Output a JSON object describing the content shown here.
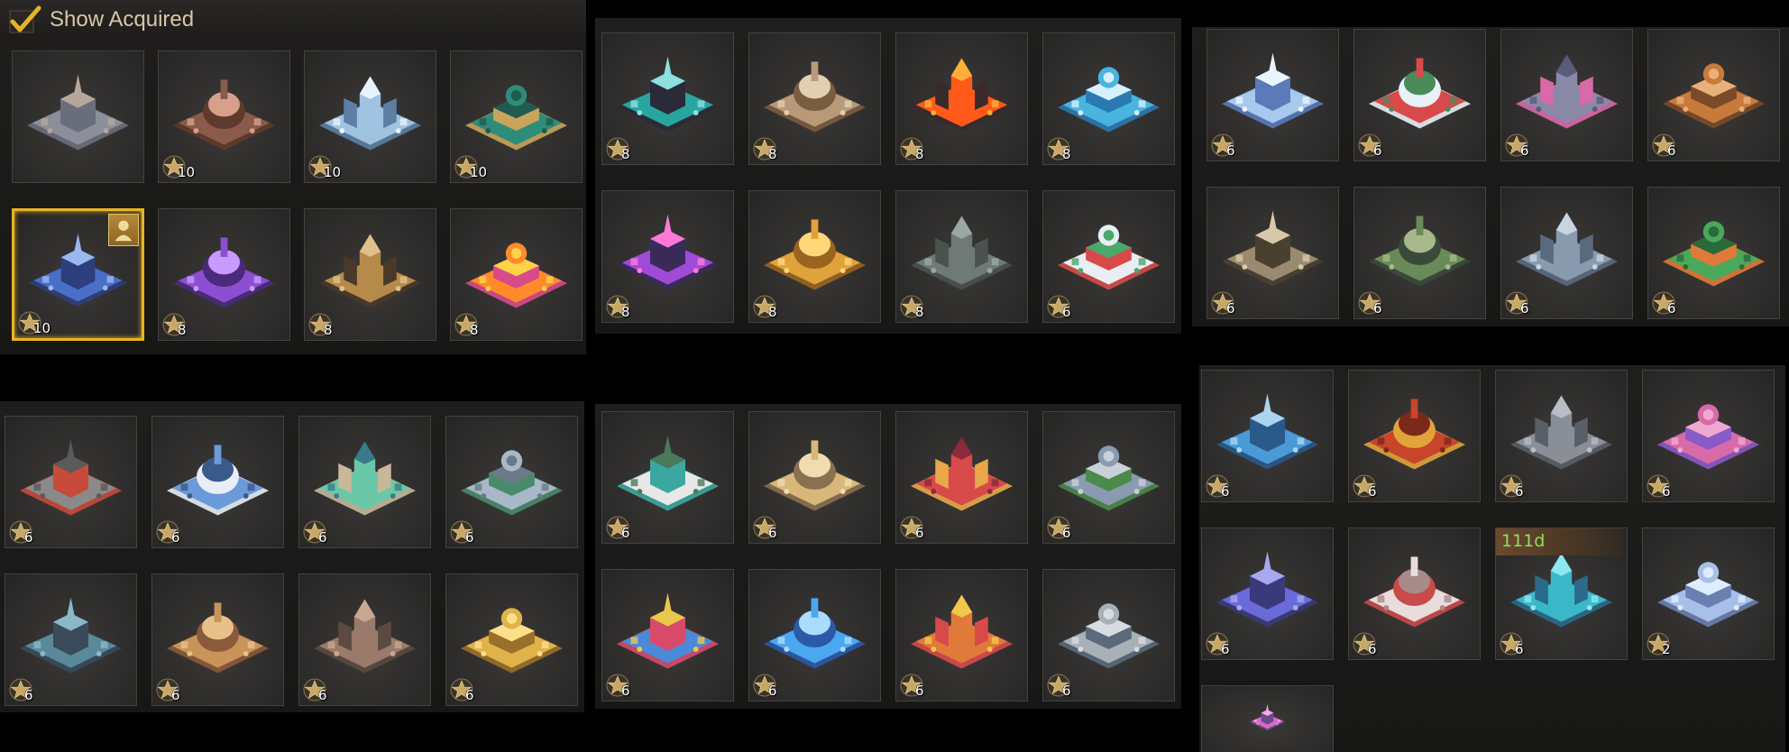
{
  "header": {
    "show_acquired_label": "Show Acquired"
  },
  "colors": {
    "star": "#c9a865",
    "selected_border": "#e6b424",
    "timer_text": "#8fe05a"
  },
  "panels": [
    {
      "id": "p1",
      "tiles": [
        {
          "name": "gray-fortress",
          "stars": "",
          "selected": false,
          "palette": [
            "#8b8f9c",
            "#6a6e7c",
            "#b7a79a"
          ]
        },
        {
          "name": "doll-face-building",
          "stars": "10",
          "selected": false,
          "palette": [
            "#8a5a4a",
            "#5e3b2c",
            "#d6a08a"
          ]
        },
        {
          "name": "cloud-city",
          "stars": "10",
          "selected": false,
          "palette": [
            "#9fc3e0",
            "#5d7fa3",
            "#e8f2fb"
          ]
        },
        {
          "name": "jade-palace",
          "stars": "10",
          "selected": false,
          "palette": [
            "#2e8c7a",
            "#caa45a",
            "#1f5b4f"
          ]
        },
        {
          "name": "blue-castle",
          "stars": "10",
          "selected": true,
          "owner": true,
          "palette": [
            "#4a6fc9",
            "#2d3f7c",
            "#9bb7ef"
          ]
        },
        {
          "name": "purple-mech",
          "stars": "8",
          "selected": false,
          "palette": [
            "#8b4fd1",
            "#4b2a7c",
            "#c79aff"
          ]
        },
        {
          "name": "skull-clockwork",
          "stars": "8",
          "selected": false,
          "palette": [
            "#b58a4a",
            "#4a3828",
            "#e0c08a"
          ]
        },
        {
          "name": "pumpkin-lantern",
          "stars": "8",
          "selected": false,
          "palette": [
            "#ff8a2a",
            "#d84a8a",
            "#ffd24a"
          ]
        }
      ]
    },
    {
      "id": "p2",
      "tiles": [
        {
          "name": "pirate-ship",
          "stars": "8",
          "selected": false,
          "palette": [
            "#27a6a0",
            "#2a2a38",
            "#8de0e0"
          ]
        },
        {
          "name": "cat-statue",
          "stars": "8",
          "selected": false,
          "palette": [
            "#b89a78",
            "#7a5c40",
            "#e2cfb2"
          ]
        },
        {
          "name": "lava-volcano",
          "stars": "8",
          "selected": false,
          "palette": [
            "#ff5a1a",
            "#3a2a2a",
            "#ffae3a"
          ]
        },
        {
          "name": "ice-spire-plaza",
          "stars": "8",
          "selected": false,
          "palette": [
            "#4ab4e0",
            "#2a7ab0",
            "#d6f0ff"
          ]
        },
        {
          "name": "neon-arcade",
          "stars": "8",
          "selected": false,
          "palette": [
            "#a04ad8",
            "#3a2a5a",
            "#ff7ad8"
          ]
        },
        {
          "name": "golden-dragon",
          "stars": "8",
          "selected": false,
          "palette": [
            "#e0a23a",
            "#9a6420",
            "#ffd67a"
          ]
        },
        {
          "name": "stone-fort",
          "stars": "8",
          "selected": false,
          "palette": [
            "#6f7a76",
            "#4a524e",
            "#9aa8a2"
          ]
        },
        {
          "name": "snowman-festival",
          "stars": "6",
          "selected": false,
          "palette": [
            "#e8eef4",
            "#d84a4a",
            "#4aa86a"
          ]
        }
      ]
    },
    {
      "id": "p3",
      "tiles": [
        {
          "name": "frost-castle",
          "stars": "6",
          "selected": false,
          "palette": [
            "#a8c8ee",
            "#5a7ab8",
            "#eaf4ff"
          ]
        },
        {
          "name": "snow-globe",
          "stars": "6",
          "selected": false,
          "palette": [
            "#d84a4a",
            "#e8f0f8",
            "#4a8a5a"
          ]
        },
        {
          "name": "carnival-block",
          "stars": "6",
          "selected": false,
          "palette": [
            "#8a8aa8",
            "#d86aa8",
            "#5a5a7a"
          ]
        },
        {
          "name": "turkey-house",
          "stars": "6",
          "selected": false,
          "palette": [
            "#c87a3a",
            "#7a4a2a",
            "#e8b07a"
          ]
        },
        {
          "name": "skull-machine",
          "stars": "6",
          "selected": false,
          "palette": [
            "#9a8a70",
            "#4a4030",
            "#d8c8a8"
          ]
        },
        {
          "name": "dragon-temple",
          "stars": "6",
          "selected": false,
          "palette": [
            "#6a8a5a",
            "#3a4a3a",
            "#a8b88a"
          ]
        },
        {
          "name": "grand-hall",
          "stars": "6",
          "selected": false,
          "palette": [
            "#8a9aae",
            "#5a6a7e",
            "#c8d4e0"
          ]
        },
        {
          "name": "tropical-garden",
          "stars": "6",
          "selected": false,
          "palette": [
            "#4aa85a",
            "#e07a3a",
            "#2a6a3a"
          ]
        }
      ]
    },
    {
      "id": "p4",
      "tiles": [
        {
          "name": "military-base",
          "stars": "6",
          "selected": false,
          "palette": [
            "#8a8a8a",
            "#c84a3a",
            "#5a5a5a"
          ]
        },
        {
          "name": "research-lab",
          "stars": "6",
          "selected": false,
          "palette": [
            "#6a9ad8",
            "#e8eef6",
            "#3a5a8a"
          ]
        },
        {
          "name": "sports-complex",
          "stars": "6",
          "selected": false,
          "palette": [
            "#6ac8a8",
            "#c8b89a",
            "#3a7a8a"
          ]
        },
        {
          "name": "stadium",
          "stars": "6",
          "selected": false,
          "palette": [
            "#a8b8c8",
            "#4a8a6a",
            "#6a7a8a"
          ]
        },
        {
          "name": "haunted-mansion",
          "stars": "6",
          "selected": false,
          "palette": [
            "#5a8a9a",
            "#3a4a5a",
            "#8ab8c8"
          ]
        },
        {
          "name": "market-district",
          "stars": "6",
          "selected": false,
          "palette": [
            "#c8945a",
            "#8a5a3a",
            "#e8c08a"
          ]
        },
        {
          "name": "industrial-works",
          "stars": "6",
          "selected": false,
          "palette": [
            "#9a7a6a",
            "#5a4a40",
            "#c8a890"
          ]
        },
        {
          "name": "golden-moon-palace",
          "stars": "6",
          "selected": false,
          "palette": [
            "#e0b24a",
            "#9a7028",
            "#fae08a"
          ]
        }
      ]
    },
    {
      "id": "p5",
      "tiles": [
        {
          "name": "modern-villa",
          "stars": "6",
          "selected": false,
          "palette": [
            "#e8e8e8",
            "#3aa8a0",
            "#4a7a5a"
          ]
        },
        {
          "name": "domed-temple",
          "stars": "6",
          "selected": false,
          "palette": [
            "#d8b87a",
            "#8a7050",
            "#f0dcb0"
          ]
        },
        {
          "name": "festival-stage",
          "stars": "6",
          "selected": false,
          "palette": [
            "#d84a4a",
            "#e8a84a",
            "#8a2a3a"
          ]
        },
        {
          "name": "opera-house",
          "stars": "6",
          "selected": false,
          "palette": [
            "#8a9ab0",
            "#4a8a4a",
            "#c8d0da"
          ]
        },
        {
          "name": "fairground",
          "stars": "6",
          "selected": false,
          "palette": [
            "#4a8ad8",
            "#d84a6a",
            "#e8c84a"
          ]
        },
        {
          "name": "rabbit-ice-statue",
          "stars": "6",
          "selected": false,
          "palette": [
            "#4aa8f0",
            "#2a5aa8",
            "#aadcff"
          ]
        },
        {
          "name": "bunny-circus",
          "stars": "6",
          "selected": false,
          "palette": [
            "#e07a3a",
            "#d84a4a",
            "#f0c84a"
          ]
        },
        {
          "name": "imperial-compound",
          "stars": "6",
          "selected": false,
          "palette": [
            "#a8b0b8",
            "#5a6a7a",
            "#d8dce0"
          ]
        }
      ]
    },
    {
      "id": "p6",
      "tiles": [
        {
          "name": "observatory-dome",
          "stars": "6",
          "selected": false,
          "palette": [
            "#4a9ad8",
            "#2a5a8a",
            "#aad4f0"
          ]
        },
        {
          "name": "red-pagoda",
          "stars": "6",
          "selected": false,
          "palette": [
            "#c8442a",
            "#e0a43a",
            "#7a2a1a"
          ]
        },
        {
          "name": "tank-fortress",
          "stars": "6",
          "selected": false,
          "palette": [
            "#8a8e96",
            "#5a5e66",
            "#b8bcc4"
          ]
        },
        {
          "name": "love-carnival",
          "stars": "6",
          "selected": false,
          "palette": [
            "#d86aa8",
            "#8a5ac8",
            "#f0a8d0"
          ]
        },
        {
          "name": "violet-castle",
          "stars": "6",
          "selected": false,
          "palette": [
            "#6a6ad8",
            "#3a3a7a",
            "#a8a8f0"
          ]
        },
        {
          "name": "winter-palace",
          "stars": "6",
          "selected": false,
          "palette": [
            "#e8dcdc",
            "#c84a4a",
            "#a88a8a"
          ]
        },
        {
          "name": "crystal-citadel",
          "stars": "6",
          "selected": false,
          "timer": "111d",
          "palette": [
            "#3ab8c8",
            "#2a6a8a",
            "#8ae8f0"
          ]
        },
        {
          "name": "ice-palace",
          "stars": "2",
          "selected": false,
          "palette": [
            "#a8c0e8",
            "#6a80b0",
            "#e0ecff"
          ]
        },
        {
          "name": "blossom-tower",
          "stars": "",
          "selected": false,
          "partial": true,
          "palette": [
            "#d86ac8",
            "#6a4a8a",
            "#f0a8e8"
          ]
        }
      ]
    }
  ]
}
